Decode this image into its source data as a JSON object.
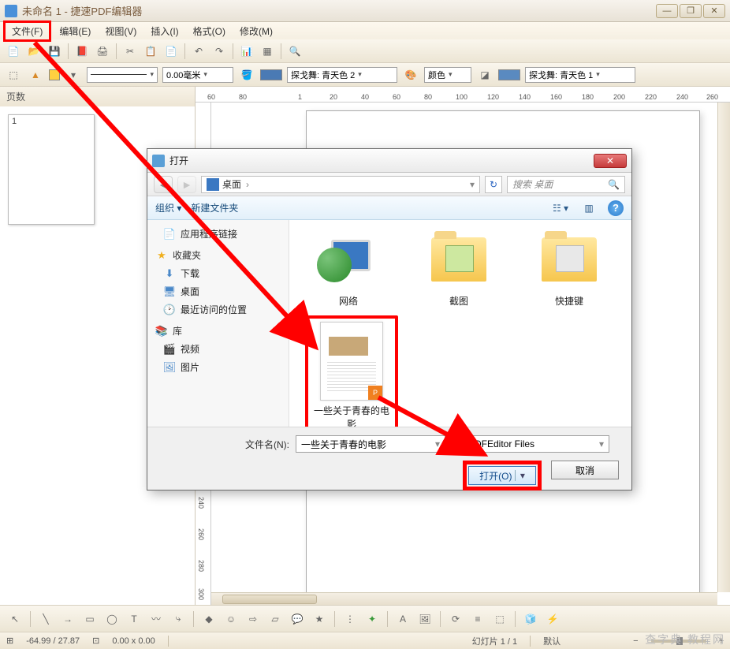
{
  "window": {
    "title": "未命名 1 - 捷速PDF编辑器",
    "min": "—",
    "max": "❐",
    "close": "✕"
  },
  "menu": {
    "file": "文件(F)",
    "edit": "编辑(E)",
    "view": "视图(V)",
    "insert": "插入(I)",
    "format": "格式(O)",
    "modify": "修改(M)"
  },
  "toolbar2": {
    "size_value": "0.00毫米",
    "style1": "探戈舞: 青天色 2",
    "color_label": "颜色",
    "style2": "探戈舞: 青天色 1"
  },
  "ruler": {
    "m60": "60",
    "m80": "80",
    "z": "1",
    "p20": "20",
    "p40": "40",
    "p60": "60",
    "p80": "80",
    "p100": "100",
    "p120": "120",
    "p140": "140",
    "p160": "160",
    "p180": "180",
    "p200": "200",
    "p220": "220",
    "p240": "240",
    "p260": "260"
  },
  "sidebar": {
    "title": "页数",
    "page_num": "1"
  },
  "ruler_v": {
    "a": "240",
    "b": "260",
    "c": "280",
    "d": "300"
  },
  "dialog": {
    "title": "打开",
    "crumb_loc": "桌面",
    "crumb_sep": "›",
    "search_placeholder": "搜索 桌面",
    "organize": "组织 ▾",
    "newfolder": "新建文件夹",
    "side": {
      "apps": "应用程序链接",
      "fav_header": "收藏夹",
      "downloads": "下载",
      "desktop": "桌面",
      "recent": "最近访问的位置",
      "lib_header": "库",
      "videos": "视频",
      "pictures": "图片"
    },
    "files": {
      "network": "网络",
      "screenshot": "截图",
      "shortcut": "快捷键",
      "selected": "一些关于青春的电影"
    },
    "filename_label": "文件名(N):",
    "filename_value": "一些关于青春的电影",
    "filetype_value": "JSPDFEditor Files",
    "open_btn": "打开(O)",
    "open_arrow": "▾",
    "cancel_btn": "取消"
  },
  "status": {
    "coords": "-64.99 / 27.87",
    "size": "0.00 x 0.00",
    "slide": "幻灯片 1 / 1",
    "mode": "默认"
  },
  "watermark": "查字典 教程网"
}
